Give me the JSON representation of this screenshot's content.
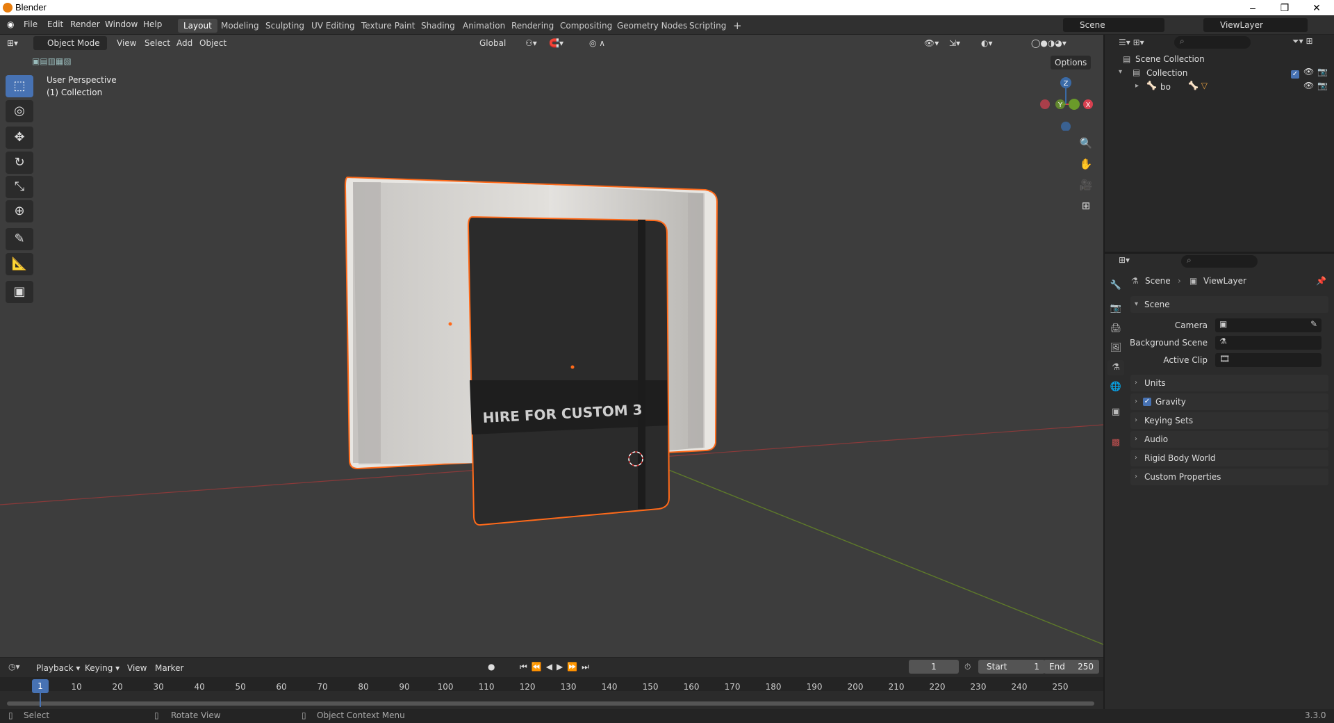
{
  "app": {
    "title": "Blender",
    "version": "3.3.0"
  },
  "window_controls": {
    "minimize": "–",
    "restore": "❐",
    "close": "✕"
  },
  "menus": [
    "File",
    "Edit",
    "Render",
    "Window",
    "Help"
  ],
  "workspaces": [
    "Layout",
    "Modeling",
    "Sculpting",
    "UV Editing",
    "Texture Paint",
    "Shading",
    "Animation",
    "Rendering",
    "Compositing",
    "Geometry Nodes",
    "Scripting"
  ],
  "workspace_add": "+",
  "active_workspace": "Layout",
  "scene_field": "Scene",
  "viewlayer_field": "ViewLayer",
  "viewport_header": {
    "mode": "Object Mode",
    "menus": [
      "View",
      "Select",
      "Add",
      "Object"
    ],
    "orientation": "Global",
    "options": "Options"
  },
  "viewport": {
    "perspective": "User Perspective",
    "collection": "(1) Collection",
    "notebook_text": "HIRE FOR CUSTOM 3"
  },
  "gizmo": {
    "z": "Z",
    "y": "Y",
    "x": "X"
  },
  "tools": [
    "select-box",
    "cursor",
    "move",
    "rotate",
    "scale",
    "transform",
    "annotate",
    "measure",
    "add-cube"
  ],
  "outliner": {
    "root": "Scene Collection",
    "collection": "Collection",
    "object": "bo"
  },
  "properties": {
    "breadcrumb": [
      "Scene",
      "ViewLayer"
    ],
    "sections": {
      "scene": "Scene",
      "camera_label": "Camera",
      "background_label": "Background Scene",
      "clip_label": "Active Clip"
    },
    "collapsed": [
      "Units",
      "Gravity",
      "Keying Sets",
      "Audio",
      "Rigid Body World",
      "Custom Properties"
    ],
    "gravity_checked": true
  },
  "timeline": {
    "menus": [
      "Playback",
      "Keying",
      "View",
      "Marker"
    ],
    "current_frame": "1",
    "start_label": "Start",
    "start_value": "1",
    "end_label": "End",
    "end_value": "250",
    "ticks": [
      "1",
      "10",
      "20",
      "30",
      "40",
      "50",
      "60",
      "70",
      "80",
      "90",
      "100",
      "110",
      "120",
      "130",
      "140",
      "150",
      "160",
      "170",
      "180",
      "190",
      "200",
      "210",
      "220",
      "230",
      "240",
      "250"
    ]
  },
  "status": {
    "select": "Select",
    "rotate": "Rotate View",
    "context": "Object Context Menu"
  }
}
